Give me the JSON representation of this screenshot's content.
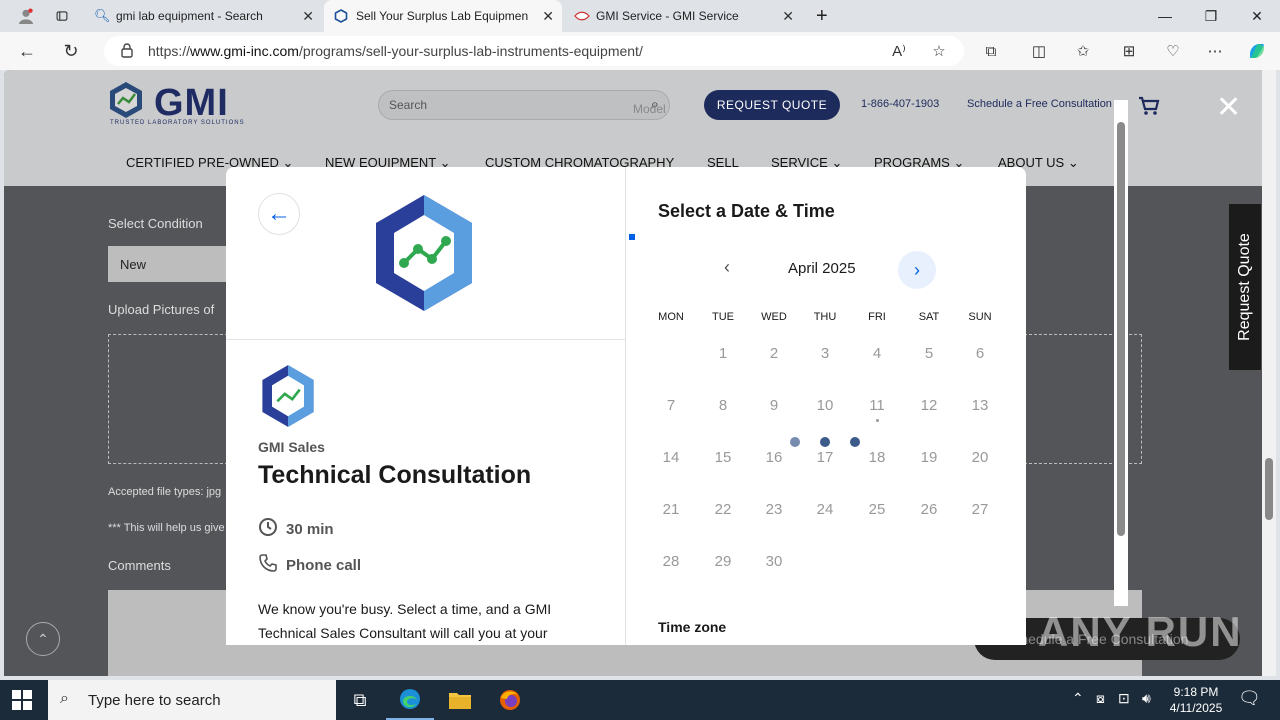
{
  "browser": {
    "tabs": [
      {
        "title": "gmi lab equipment - Search"
      },
      {
        "title": "Sell Your Surplus Lab Equipment"
      },
      {
        "title": "GMI Service - GMI Service"
      }
    ],
    "url_prefix": "https://",
    "url_host": "www.gmi-inc.com",
    "url_path": "/programs/sell-your-surplus-lab-instruments-equipment/"
  },
  "site": {
    "logo_text": "GMI",
    "logo_sub": "TRUSTED LABORATORY SOLUTIONS",
    "search_placeholder": "Search",
    "request_quote": "REQUEST QUOTE",
    "phone": "1-866-407-1903",
    "schedule": "Schedule a Free Consultation",
    "nav": [
      "CERTIFIED PRE-OWNED",
      "NEW EQUIPMENT",
      "CUSTOM CHROMATOGRAPHY",
      "SELL",
      "SERVICE",
      "PROGRAMS",
      "ABOUT US"
    ],
    "form": {
      "select_condition": "Select Condition",
      "condition_value": "New",
      "upload_pictures": "Upload Pictures of",
      "accepted": "Accepted file types: jpg",
      "help_note": "*** This will help us give",
      "comments": "Comments",
      "model": "Model"
    },
    "side_request_quote": "Request Quote",
    "schedule_pill": "Schedule a Free Consultation",
    "watermark": "ANY RUN"
  },
  "widget": {
    "org": "GMI Sales",
    "event": "Technical Consultation",
    "duration": "30 min",
    "location": "Phone call",
    "description": "We know you're busy. Select a time, and a GMI Technical Sales Consultant will call you at your",
    "right_title": "Select a Date & Time",
    "month": "April 2025",
    "weekdays": [
      "MON",
      "TUE",
      "WED",
      "THU",
      "FRI",
      "SAT",
      "SUN"
    ],
    "weeks": [
      [
        "",
        "1",
        "2",
        "3",
        "4",
        "5",
        "6"
      ],
      [
        "7",
        "8",
        "9",
        "10",
        "11",
        "12",
        "13"
      ],
      [
        "14",
        "15",
        "16",
        "17",
        "18",
        "19",
        "20"
      ],
      [
        "21",
        "22",
        "23",
        "24",
        "25",
        "26",
        "27"
      ],
      [
        "28",
        "29",
        "30",
        "",
        "",
        "",
        ""
      ]
    ],
    "timezone_label": "Time zone"
  },
  "taskbar": {
    "search_placeholder": "Type here to search",
    "time": "9:18 PM",
    "date": "4/11/2025"
  }
}
